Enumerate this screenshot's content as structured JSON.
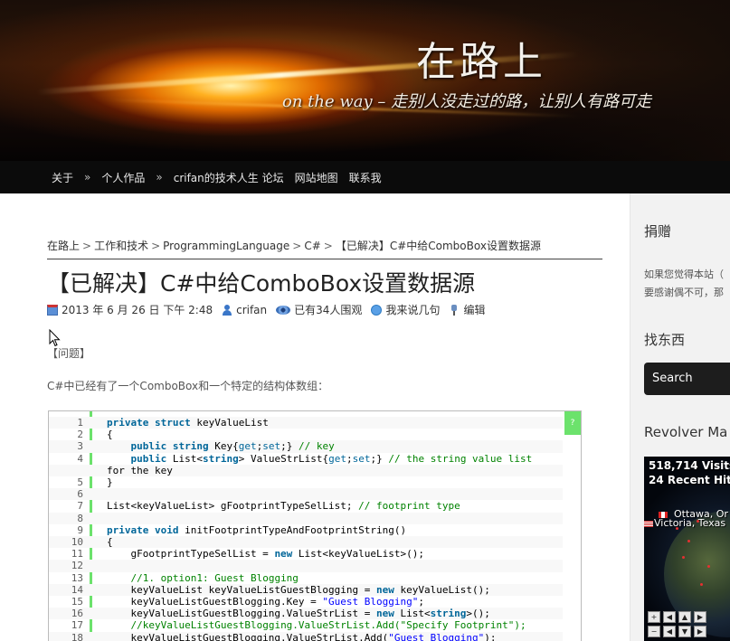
{
  "header": {
    "site_title": "在路上",
    "site_subtitle": "on the way – 走别人没走过的路，让别人有路可走"
  },
  "nav": {
    "items": [
      "关于",
      "个人作品",
      "crifan的技术人生 论坛",
      "网站地图",
      "联系我"
    ],
    "separator": "»"
  },
  "breadcrumb": {
    "items": [
      "在路上",
      "工作和技术",
      "ProgrammingLanguage",
      "C#",
      "【已解决】C#中给ComboBox设置数据源"
    ],
    "separator": ">"
  },
  "post": {
    "title": "【已解决】C#中给ComboBox设置数据源",
    "meta": {
      "date": "2013 年 6 月 26 日 下午 2:48",
      "author": "crifan",
      "views": "已有34人围观",
      "comment": "我来说几句",
      "edit": "编辑"
    },
    "problem_label": "【问题】",
    "intro": "C#中已经有了一个ComboBox和一个特定的结构体数组："
  },
  "code": {
    "help_button": "?",
    "lines": [
      {
        "n": "1",
        "text": "private struct keyValueList"
      },
      {
        "n": "2",
        "text": "{"
      },
      {
        "n": "3",
        "text": "    public string Key{get;set;} // key"
      },
      {
        "n": "4",
        "text": "    public List<string> ValueStrList{get;set;} // the string value list"
      },
      {
        "n": "",
        "text": "for the key"
      },
      {
        "n": "5",
        "text": "}"
      },
      {
        "n": "6",
        "text": ""
      },
      {
        "n": "7",
        "text": "List<keyValueList> gFootprintTypeSelList; // footprint type"
      },
      {
        "n": "8",
        "text": ""
      },
      {
        "n": "9",
        "text": "private void initFootprintTypeAndFootprintString()"
      },
      {
        "n": "10",
        "text": "{"
      },
      {
        "n": "11",
        "text": "    gFootprintTypeSelList = new List<keyValueList>();"
      },
      {
        "n": "12",
        "text": ""
      },
      {
        "n": "13",
        "text": "    //1. option1: Guest Blogging"
      },
      {
        "n": "14",
        "text": "    keyValueList keyValueListGuestBlogging = new keyValueList();"
      },
      {
        "n": "15",
        "text": "    keyValueListGuestBlogging.Key = \"Guest Blogging\";"
      },
      {
        "n": "16",
        "text": "    keyValueListGuestBlogging.ValueStrList = new List<string>();"
      },
      {
        "n": "17",
        "text": "    //keyValueListGuestBlogging.ValueStrList.Add(\"Specify Footprint\");"
      },
      {
        "n": "18",
        "text": "    keyValueListGuestBlogging.ValueStrList.Add(\"Guest Blogging\");"
      }
    ]
  },
  "sidebar": {
    "donate_title": "捐赠",
    "donate_text_1": "如果您觉得本站（",
    "donate_text_2": "要感谢偶不可，那",
    "search_title": "找东西",
    "search_label": "Search",
    "revolver_title": "Revolver Ma",
    "visits": "518,714 Visits",
    "recent_hits": "24 Recent Hits",
    "loc_1": "Ottawa, Or",
    "loc_2": "Victoria, Texas"
  },
  "colors": {
    "nav_bg": "#0b0b0b",
    "code_gutter": "#6ce26c",
    "keyword": "#006699",
    "comment": "#008200",
    "string": "#0000ff"
  }
}
